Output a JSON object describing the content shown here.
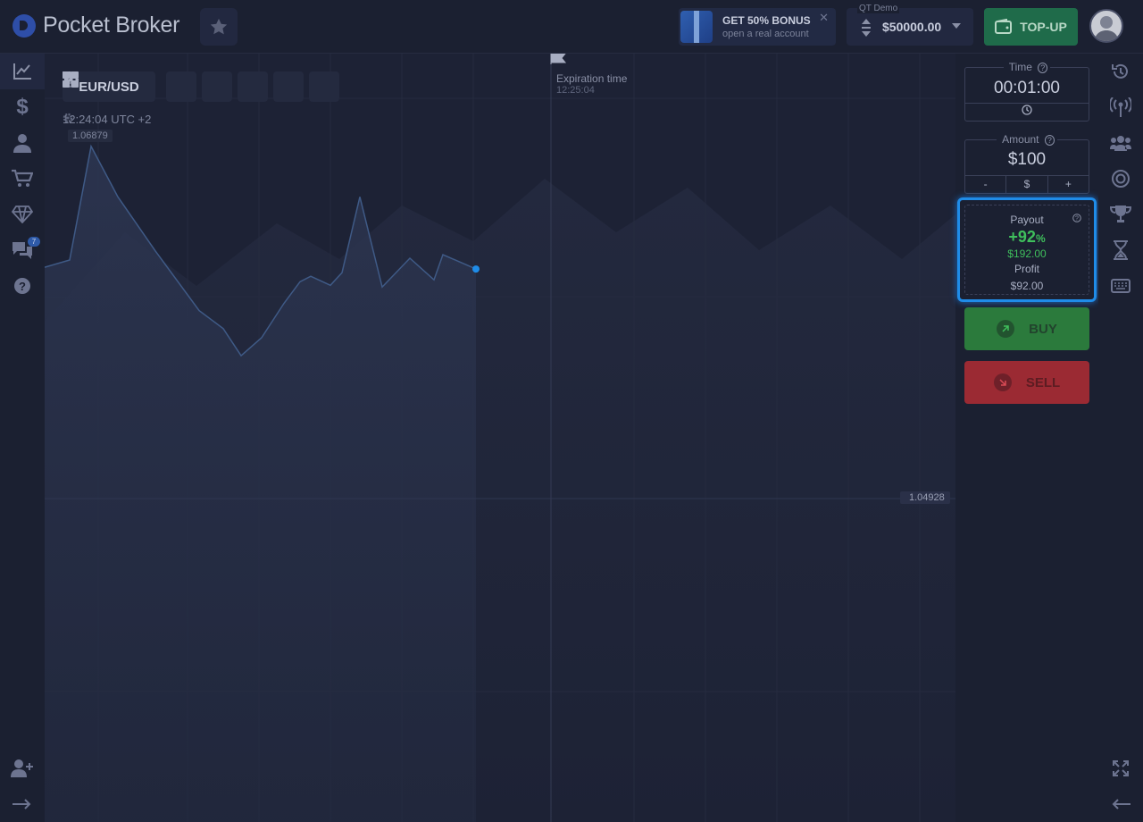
{
  "header": {
    "brand": "Pocket Broker",
    "bonus_title": "GET 50% BONUS",
    "bonus_subtitle": "open a real account",
    "account_label": "QT Demo",
    "balance": "$50000.00",
    "topup_label": "TOP-UP"
  },
  "left_sidebar": {
    "items": [
      "trading-icon",
      "finance-icon",
      "profile-icon",
      "market-icon",
      "achievements-icon",
      "chat-icon",
      "help-icon"
    ],
    "chat_badge": "7",
    "bottom_items": [
      "add-user-icon",
      "expand-icon"
    ]
  },
  "chart": {
    "pair": "EUR/USD",
    "clock": "12:24:04 UTC +2",
    "high_price": "1.06879",
    "current_price": "1.04928",
    "expiration_label": "Expiration time",
    "expiration_time": "12:25:04",
    "series": [
      1.0621,
      1.0625,
      1.0688,
      1.066,
      1.063,
      1.0597,
      1.0587,
      1.0572,
      1.0582,
      1.0601,
      1.0613,
      1.0616,
      1.0611,
      1.0618,
      1.066,
      1.061,
      1.0626,
      1.0614,
      1.0628,
      1.062
    ]
  },
  "trade": {
    "time_label": "Time",
    "time_value": "00:01:00",
    "amount_label": "Amount",
    "amount_value": "$100",
    "minus": "-",
    "currency": "$",
    "plus": "+",
    "payout_label": "Payout",
    "payout_pct": "+92",
    "payout_pct_sign": "%",
    "payout_amount": "$192.00",
    "profit_label": "Profit",
    "profit_amount": "$92.00",
    "buy_label": "BUY",
    "sell_label": "SELL"
  },
  "right_sidebar": {
    "items": [
      "history-icon",
      "signals-icon",
      "social-icon",
      "express-icon",
      "tournaments-icon",
      "pending-icon",
      "hotkeys-icon"
    ],
    "bottom_items": [
      "fullscreen-icon",
      "collapse-icon"
    ]
  },
  "colors": {
    "accent_blue": "#1f8ce8",
    "buy_green": "#2b7a3c",
    "sell_red": "#9b2a33",
    "payout_green": "#3fbf5c"
  }
}
